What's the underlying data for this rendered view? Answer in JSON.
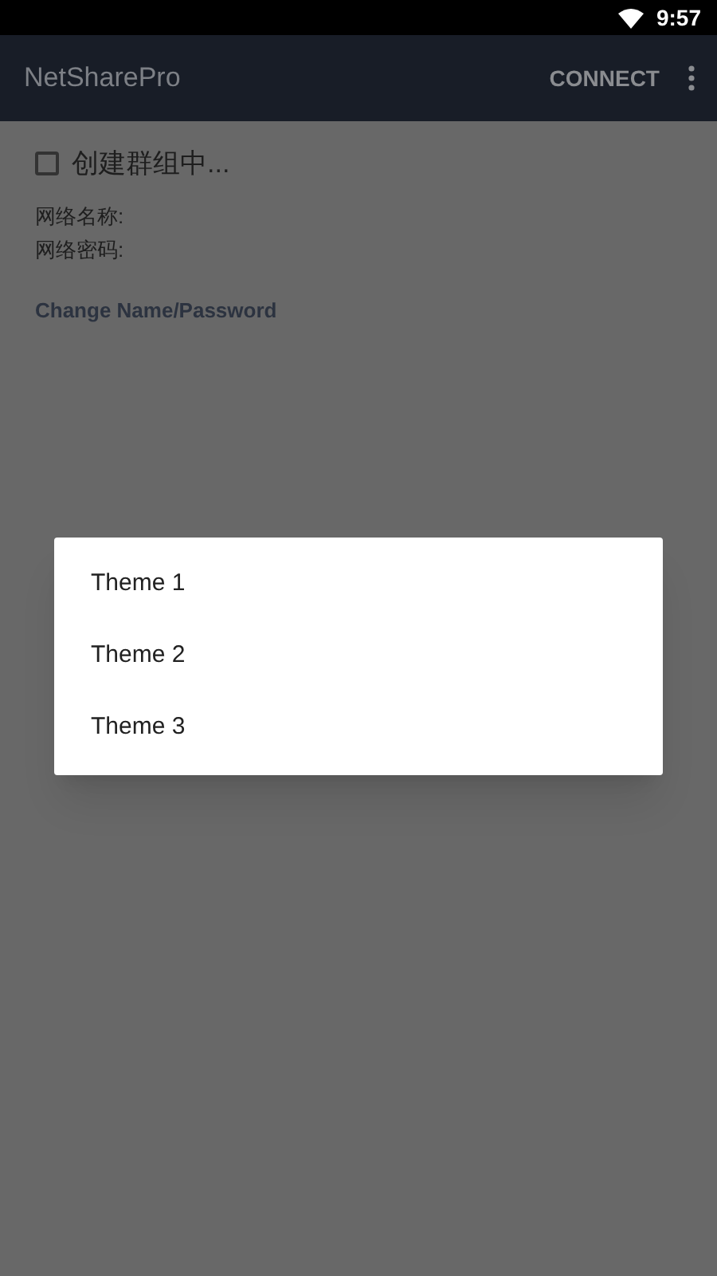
{
  "status_bar": {
    "time": "9:57"
  },
  "app_bar": {
    "title": "NetSharePro",
    "action": "CONNECT"
  },
  "group": {
    "label": "创建群组中...",
    "checked": false
  },
  "network_name_label": "网络名称:",
  "network_password_label": "网络密码:",
  "change_link": "Change Name/Password",
  "theme_dialog": {
    "items": [
      {
        "label": "Theme 1"
      },
      {
        "label": "Theme 2"
      },
      {
        "label": "Theme 3"
      }
    ]
  }
}
